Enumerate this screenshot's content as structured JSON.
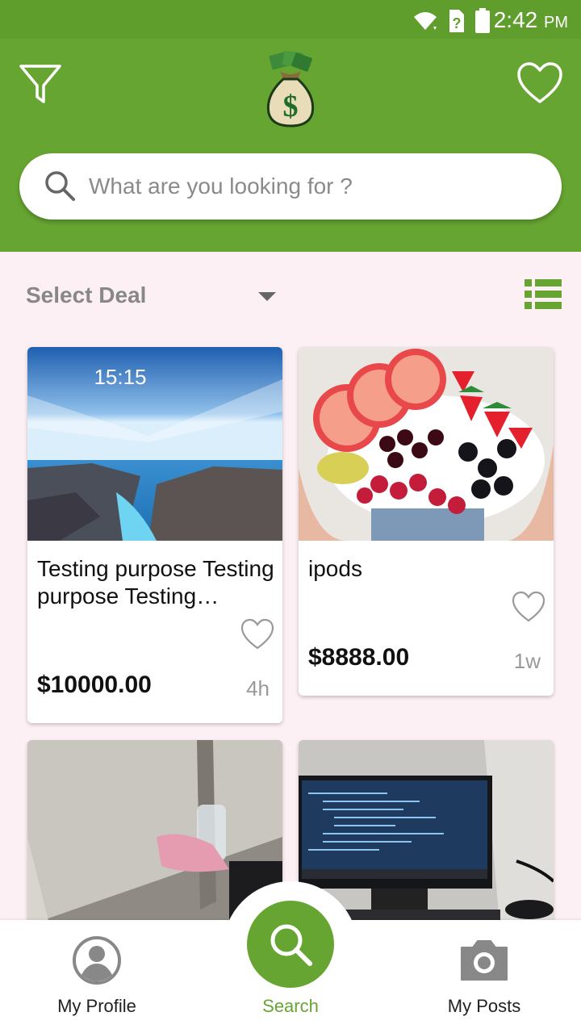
{
  "status_bar": {
    "time": "2:42",
    "ampm": "PM"
  },
  "header": {
    "filter_icon": "filter-icon",
    "logo_icon": "money-bag-icon",
    "favorites_icon": "heart-outline-icon"
  },
  "search": {
    "placeholder": "What are you looking for ?"
  },
  "filter": {
    "select_label": "Select Deal",
    "view_icon": "list-view-icon"
  },
  "listings": [
    {
      "title": "Testing purpose Testing purpose Testing purpose",
      "price": "$10000.00",
      "age": "4h",
      "image": "phone-lockscreen-photo"
    },
    {
      "title": "ipods",
      "price": "$8888.00",
      "age": "1w",
      "image": "fruit-plate-photo"
    },
    {
      "title": "",
      "price": "",
      "age": "",
      "image": "office-desk-photo"
    },
    {
      "title": "",
      "price": "",
      "age": "",
      "image": "computer-monitor-photo"
    }
  ],
  "lockscreen_time": "15:15",
  "bottom_nav": {
    "profile_label": "My Profile",
    "search_label": "Search",
    "posts_label": "My Posts"
  },
  "colors": {
    "primary": "#67A532",
    "status": "#5F9D2C",
    "background": "#FDF0F5"
  }
}
